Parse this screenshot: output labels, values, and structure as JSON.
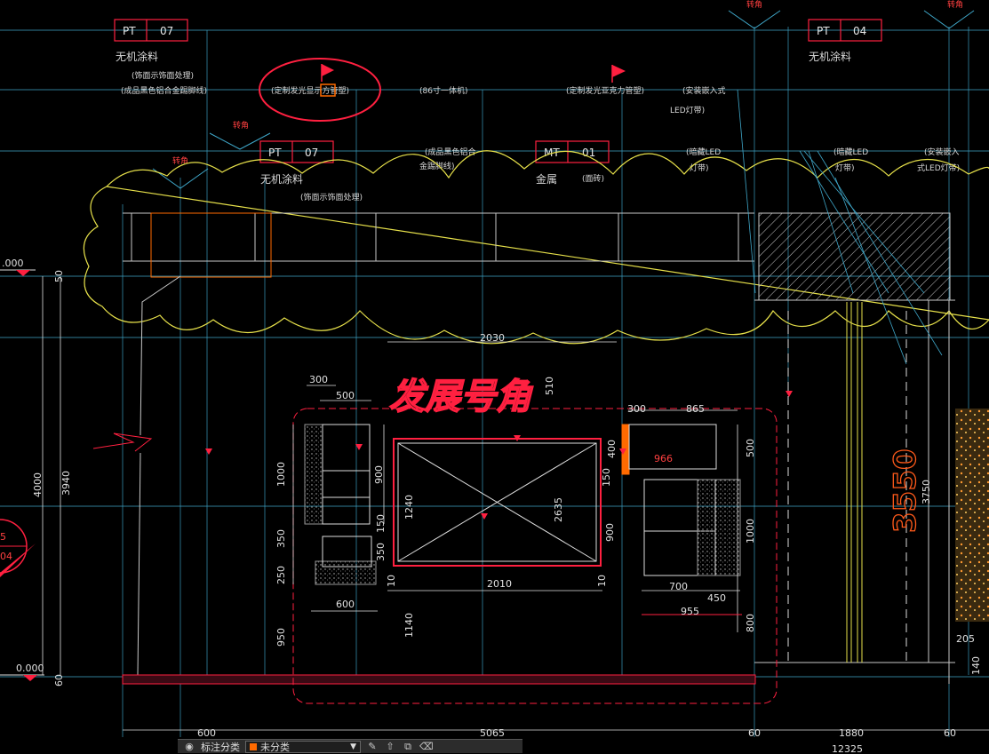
{
  "colors": {
    "background": "#000000",
    "grid_cyan": "#3fa7c9",
    "cloud_yellow": "#e6e04a",
    "markup_red": "#ff2040",
    "dim_white": "#e0e0e0",
    "orange": "#ff6a00"
  },
  "tags": {
    "pt07_top": {
      "code": "PT",
      "num": "07"
    },
    "pt04_top": {
      "code": "PT",
      "num": "04"
    },
    "pt07_mid": {
      "code": "PT",
      "num": "07"
    },
    "mt01_mid": {
      "code": "MT",
      "num": "01"
    }
  },
  "labels": {
    "wuji_top_left": "无机涂料",
    "wuji_top_right": "无机涂料",
    "wuji_mid": "无机涂料",
    "jinshu": "金属",
    "zhuanjiao_1": "转角",
    "zhuanjiao_2": "转角",
    "zhuanjiao_3": "转角",
    "zhuanjiao_4": "转角",
    "note_1": "(饰面示饰面处理)",
    "note_2": "(成品黑色铝合金踢脚线)",
    "note_3": "(定制发光显示方管塑)",
    "note_4": "(86寸一体机)",
    "note_5": "(定制发光亚克力管塑)",
    "note_6": "(安装嵌入式",
    "note_7": "LED灯带)",
    "note_8": "(成品黑色铝合",
    "note_9": "金踢脚线)",
    "note_10": "(饰面示饰面处理)",
    "note_11": "(暗藏LED",
    "note_12": "灯带)",
    "note_13": "(暗藏LED",
    "note_14": "灯带)",
    "note_15": "(安装嵌入",
    "note_16": "式LED灯带)",
    "note_17": "(面砖)",
    "stylized_title": "发展号角",
    "big_dim": "3550"
  },
  "dimensions": {
    "d_2030": "2030",
    "d_510": "510",
    "d_300_left": "300",
    "d_500_left": "500",
    "d_1000_left": "1000",
    "d_900_left": "900",
    "d_350_a": "350",
    "d_250": "250",
    "d_350_b": "350",
    "d_150_a": "150",
    "d_600_small": "600",
    "d_950": "950",
    "d_1140": "1140",
    "d_1240": "1240",
    "d_2635": "2635",
    "d_2010": "2010",
    "d_10_a": "10",
    "d_10_b": "10",
    "d_300_right": "300",
    "d_865": "865",
    "d_400": "400",
    "d_966": "966",
    "d_500_right": "500",
    "d_150_b": "150",
    "d_900_right": "900",
    "d_1000_right": "1000",
    "d_700": "700",
    "d_450": "450",
    "d_955": "955",
    "d_800": "800",
    "d_3750": "3750",
    "d_205": "205",
    "d_140": "140",
    "d_4000": "4000",
    "d_3940": "3940",
    "d_50": "50",
    "d_60": "60",
    "level_top": ".000",
    "level_bottom": "0.000",
    "bottom_600": "600",
    "bottom_5065": "5065",
    "bottom_60_a": "60",
    "bottom_1880": "1880",
    "bottom_60_b": "60",
    "bottom_partial": "12325",
    "section_num_top": "5",
    "section_num_bottom": "04"
  },
  "toolbar": {
    "label_1": "标注分类",
    "layer_name": "未分类"
  }
}
